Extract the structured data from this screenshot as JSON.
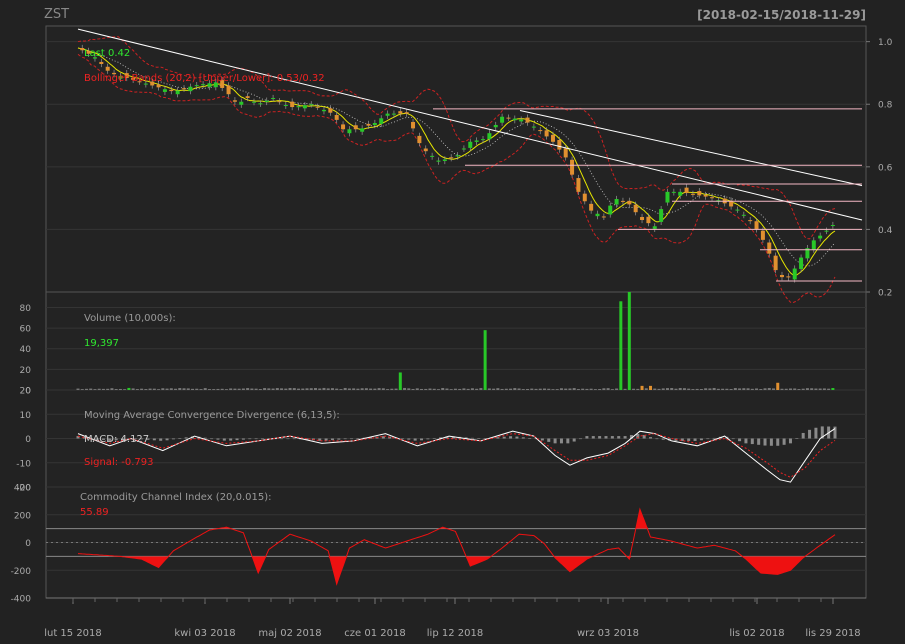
{
  "header": {
    "symbol": "ZST",
    "range": "[2018-02-15/2018-11-29]"
  },
  "colors": {
    "bg": "#222222",
    "panel": "#232323",
    "grid": "#343434",
    "axis": "#777777",
    "up": "#28c828",
    "down": "#e09030",
    "bb": "#cc2222",
    "ma": "#e6e600",
    "macd": "#ffffff",
    "signal": "#ee2222",
    "cci": "#ee1111",
    "trend": "#ffffff",
    "level": "#f4b8c4",
    "green_text": "#30e830",
    "red_text": "#ee2222"
  },
  "price_panel": {
    "last_label": "Last 0.42",
    "bb_label": "Bollinger Bands (20,2) [Upper/Lower]: 0.53/0.32",
    "yticks": [
      "0.2",
      "0.4",
      "0.6",
      "0.8",
      "1.0"
    ]
  },
  "volume_panel": {
    "title": "Volume (10,000s):",
    "value": "19,397",
    "yticks": [
      "0",
      "20",
      "40",
      "60",
      "80"
    ]
  },
  "macd_panel": {
    "title": "Moving Average Convergence Divergence (6,13,5):",
    "macd": "MACD: 4.127",
    "signal": "Signal: -0.793",
    "yticks": [
      "-20",
      "-10",
      "0",
      "10",
      "20"
    ]
  },
  "cci_panel": {
    "title": "Commodity Channel Index (20,0.015):",
    "value": "55.89",
    "yticks": [
      "-400",
      "-200",
      "0",
      "200",
      "400"
    ]
  },
  "xaxis": {
    "labels": [
      "lut 15 2018",
      "kwi 03 2018",
      "maj 02 2018",
      "cze 01 2018",
      "lip 12 2018",
      "wrz 03 2018",
      "lis 02 2018",
      "lis 29 2018"
    ]
  },
  "chart_data": [
    {
      "type": "candlestick",
      "title": "ZST",
      "x_range": [
        "2018-02-15",
        "2018-11-29"
      ],
      "ylim": [
        0.2,
        1.05
      ],
      "series": [
        {
          "name": "Price",
          "close_path": [
            [
              0,
              0.98
            ],
            [
              8,
              0.95
            ],
            [
              15,
              0.9
            ],
            [
              25,
              0.88
            ],
            [
              35,
              0.86
            ],
            [
              45,
              0.84
            ],
            [
              55,
              0.86
            ],
            [
              65,
              0.87
            ],
            [
              70,
              0.84
            ],
            [
              75,
              0.8
            ],
            [
              80,
              0.82
            ],
            [
              85,
              0.8
            ],
            [
              92,
              0.82
            ],
            [
              100,
              0.79
            ],
            [
              110,
              0.8
            ],
            [
              120,
              0.77
            ],
            [
              125,
              0.72
            ],
            [
              133,
              0.72
            ],
            [
              140,
              0.74
            ],
            [
              146,
              0.77
            ],
            [
              155,
              0.77
            ],
            [
              162,
              0.66
            ],
            [
              170,
              0.62
            ],
            [
              178,
              0.63
            ],
            [
              185,
              0.68
            ],
            [
              192,
              0.69
            ],
            [
              200,
              0.76
            ],
            [
              210,
              0.75
            ],
            [
              217,
              0.72
            ],
            [
              224,
              0.68
            ],
            [
              230,
              0.63
            ],
            [
              236,
              0.52
            ],
            [
              242,
              0.46
            ],
            [
              248,
              0.44
            ],
            [
              253,
              0.5
            ],
            [
              260,
              0.48
            ],
            [
              266,
              0.43
            ],
            [
              272,
              0.41
            ],
            [
              278,
              0.52
            ],
            [
              284,
              0.52
            ],
            [
              292,
              0.51
            ],
            [
              300,
              0.5
            ],
            [
              306,
              0.48
            ],
            [
              312,
              0.46
            ],
            [
              318,
              0.42
            ],
            [
              322,
              0.38
            ],
            [
              325,
              0.34
            ],
            [
              329,
              0.27
            ],
            [
              333,
              0.24
            ],
            [
              336,
              0.25
            ],
            [
              340,
              0.3
            ],
            [
              346,
              0.36
            ],
            [
              352,
              0.39
            ],
            [
              357,
              0.42
            ]
          ]
        },
        {
          "name": "Last",
          "values": [
            0.42
          ]
        }
      ]
    },
    {
      "type": "bar",
      "title": "Volume (10,000s):",
      "ylim": [
        0,
        95
      ],
      "series": [
        {
          "name": "Volume",
          "spikes": [
            [
              25,
              2
            ],
            [
              153,
              17
            ],
            [
              193,
              58
            ],
            [
              257,
              86
            ],
            [
              260,
              95
            ],
            [
              266,
              4
            ],
            [
              270,
              4
            ],
            [
              330,
              7
            ],
            [
              357,
              1.9
            ]
          ],
          "last": 19397
        }
      ]
    },
    {
      "type": "line",
      "title": "Moving Average Convergence Divergence (6,13,5):",
      "ylim": [
        -20,
        20
      ],
      "series": [
        {
          "name": "MACD",
          "points": [
            [
              0,
              2
            ],
            [
              15,
              -3
            ],
            [
              25,
              0
            ],
            [
              40,
              -5
            ],
            [
              55,
              1
            ],
            [
              70,
              -3
            ],
            [
              85,
              -1
            ],
            [
              100,
              1
            ],
            [
              115,
              -2
            ],
            [
              130,
              -1
            ],
            [
              145,
              2
            ],
            [
              160,
              -3
            ],
            [
              175,
              1
            ],
            [
              190,
              -1
            ],
            [
              205,
              3
            ],
            [
              215,
              1
            ],
            [
              225,
              -7
            ],
            [
              232,
              -11
            ],
            [
              240,
              -8
            ],
            [
              250,
              -6
            ],
            [
              258,
              -2
            ],
            [
              265,
              3
            ],
            [
              272,
              2
            ],
            [
              280,
              -1
            ],
            [
              292,
              -3
            ],
            [
              305,
              1
            ],
            [
              315,
              -6
            ],
            [
              325,
              -13
            ],
            [
              331,
              -17
            ],
            [
              336,
              -18
            ],
            [
              343,
              -9
            ],
            [
              350,
              0
            ],
            [
              357,
              4.1
            ]
          ]
        },
        {
          "name": "Signal",
          "points": [
            [
              0,
              1
            ],
            [
              15,
              -2
            ],
            [
              25,
              0
            ],
            [
              40,
              -4
            ],
            [
              55,
              0
            ],
            [
              70,
              -2
            ],
            [
              85,
              -1
            ],
            [
              100,
              1
            ],
            [
              115,
              -1
            ],
            [
              130,
              -1
            ],
            [
              145,
              1
            ],
            [
              160,
              -2
            ],
            [
              175,
              0
            ],
            [
              190,
              -1
            ],
            [
              205,
              2
            ],
            [
              215,
              1
            ],
            [
              225,
              -5
            ],
            [
              232,
              -9
            ],
            [
              240,
              -9
            ],
            [
              250,
              -7
            ],
            [
              258,
              -3
            ],
            [
              265,
              1
            ],
            [
              272,
              2
            ],
            [
              280,
              0
            ],
            [
              292,
              -2
            ],
            [
              305,
              0
            ],
            [
              315,
              -4
            ],
            [
              325,
              -10
            ],
            [
              331,
              -14
            ],
            [
              336,
              -16
            ],
            [
              343,
              -12
            ],
            [
              350,
              -5
            ],
            [
              357,
              -0.8
            ]
          ]
        }
      ]
    },
    {
      "type": "area",
      "title": "Commodity Channel Index (20,0.015):",
      "ylim": [
        -400,
        400
      ],
      "series": [
        {
          "name": "CCI",
          "points": [
            [
              0,
              -80
            ],
            [
              20,
              -100
            ],
            [
              30,
              -120
            ],
            [
              38,
              -180
            ],
            [
              45,
              -60
            ],
            [
              55,
              30
            ],
            [
              62,
              90
            ],
            [
              70,
              110
            ],
            [
              78,
              70
            ],
            [
              85,
              -220
            ],
            [
              90,
              -50
            ],
            [
              100,
              60
            ],
            [
              110,
              10
            ],
            [
              118,
              -60
            ],
            [
              122,
              -300
            ],
            [
              128,
              -40
            ],
            [
              135,
              20
            ],
            [
              145,
              -40
            ],
            [
              155,
              10
            ],
            [
              165,
              60
            ],
            [
              172,
              110
            ],
            [
              178,
              80
            ],
            [
              185,
              -170
            ],
            [
              193,
              -120
            ],
            [
              200,
              -40
            ],
            [
              208,
              60
            ],
            [
              215,
              50
            ],
            [
              220,
              -10
            ],
            [
              225,
              -110
            ],
            [
              232,
              -210
            ],
            [
              240,
              -120
            ],
            [
              250,
              -50
            ],
            [
              255,
              -40
            ],
            [
              260,
              -120
            ],
            [
              265,
              240
            ],
            [
              270,
              40
            ],
            [
              280,
              10
            ],
            [
              292,
              -40
            ],
            [
              300,
              -20
            ],
            [
              310,
              -60
            ],
            [
              315,
              -120
            ],
            [
              322,
              -220
            ],
            [
              330,
              -230
            ],
            [
              336,
              -200
            ],
            [
              342,
              -110
            ],
            [
              350,
              -20
            ],
            [
              357,
              56
            ]
          ]
        }
      ]
    }
  ]
}
